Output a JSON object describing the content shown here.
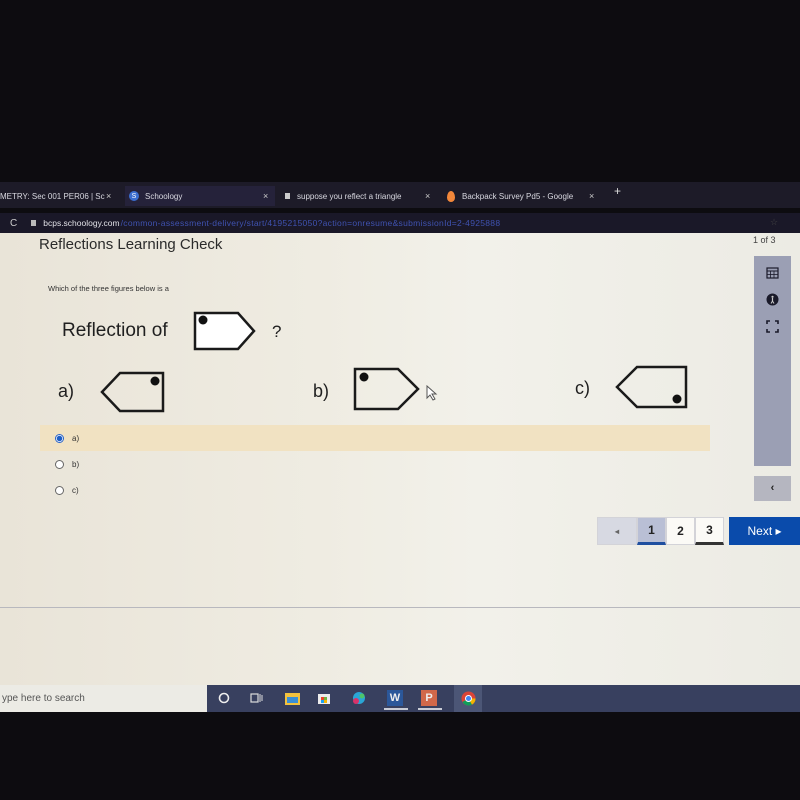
{
  "browser": {
    "tabs": [
      {
        "label": "METRY: Sec 001 PER06 | Sc",
        "icon": "none",
        "close": "×"
      },
      {
        "label": "Schoology",
        "icon": "schoology-logo",
        "close": "×"
      },
      {
        "label": "suppose you reflect a triangle",
        "icon": "document-icon",
        "close": "×"
      },
      {
        "label": "Backpack Survey Pd5 - Google",
        "icon": "forms-icon",
        "close": "×"
      }
    ],
    "new_tab": "+",
    "reload_icon": "C",
    "url_domain": "bcps.schoology.com",
    "url_path": "/common-assessment-delivery/start/4195215050?action=onresume&submissionId=2-4925888",
    "star_icon": "☆"
  },
  "assessment": {
    "title": "Reflections Learning Check",
    "counter": "1 of 3",
    "question_text": "Which of the three figures below is a",
    "reflection_label": "Reflection of",
    "question_mark": "?",
    "options": [
      {
        "label": "a)",
        "figure": "pentagon pointing left, dot top-right"
      },
      {
        "label": "b)",
        "figure": "pentagon pointing right, dot top-left"
      },
      {
        "label": "c)",
        "figure": "pentagon pointing left, dot bottom-right"
      }
    ],
    "reference_figure": "pentagon pointing right, dot top-left",
    "answers": [
      {
        "label": "a)",
        "selected": true
      },
      {
        "label": "b)",
        "selected": false
      },
      {
        "label": "c)",
        "selected": false
      }
    ],
    "side_tools": [
      "calendar-icon",
      "accessibility-icon",
      "fullscreen-icon"
    ],
    "collapse_icon": "‹"
  },
  "pagination": {
    "prev": "◂",
    "pages": [
      "1",
      "2",
      "3"
    ],
    "current": "1",
    "next_label": "Next ▸"
  },
  "taskbar": {
    "search_placeholder": "ype here to search",
    "apps": [
      "cortana-icon",
      "task-view-icon",
      "file-explorer-icon",
      "store-icon",
      "edge-icon",
      "word-icon",
      "powerpoint-icon",
      "chrome-icon"
    ],
    "word_letter": "W",
    "ppt_letter": "P"
  },
  "colors": {
    "accent": "#0a4bab",
    "selected_answer": "#f1e2c2",
    "taskbar": "#38405f"
  }
}
